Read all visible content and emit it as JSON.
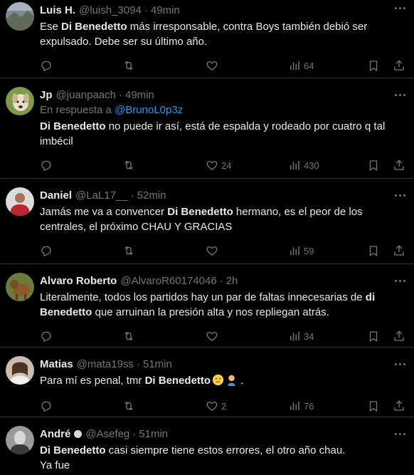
{
  "tweets": [
    {
      "name": "Luis H.",
      "handle": "@luish_3094",
      "time": "49min",
      "text_parts": [
        "Ese ",
        "Di Benedetto",
        " más irresponsable, contra Boys también debió ser expulsado. Debe ser su último año."
      ],
      "likes": "",
      "views": "64",
      "avatar_icon": "landscape-avatar"
    },
    {
      "name": "Jp",
      "handle": "@juanpaach",
      "time": "49min",
      "reply_prefix": "En respuesta a ",
      "reply_mention": "@BrunoL0p3z",
      "text_parts": [
        "Di Benedetto",
        " no puede ir así, está de espalda y rodeado por cuatro q tal imbécil"
      ],
      "likes": "24",
      "views": "430",
      "avatar_icon": "dog-avatar"
    },
    {
      "name": "Daniel",
      "handle": "@LaL17__",
      "time": "52min",
      "text_parts": [
        "Jamás me va a convencer ",
        "Di Benedetto",
        " hermano, es el peor de los centrales, el próximo CHAU Y GRACIAS"
      ],
      "likes": "",
      "views": "59",
      "avatar_icon": "player-avatar"
    },
    {
      "name": "Alvaro Roberto",
      "handle": "@AlvaroR60174046",
      "time": "2h",
      "text_parts": [
        "Literalmente, todos los partidos hay un par de faltas innecesarias de ",
        "di Benedetto",
        " que arruinan la presión alta y nos repliegan atrás."
      ],
      "likes": "",
      "views": "34",
      "avatar_icon": "dog-avatar"
    },
    {
      "name": "Matias",
      "handle": "@mata19ss",
      "time": "51min",
      "text_parts": [
        "Para mí es penal, tmr ",
        "Di Benedetto",
        ""
      ],
      "text_tail": " .",
      "likes": "2",
      "views": "76",
      "avatar_icon": "person-avatar"
    },
    {
      "name": "André",
      "handle": "@Asefeg",
      "time": "51min",
      "text_parts": [
        "Di Benedetto",
        " casi siempre tiene estos errores, el otro año chau."
      ],
      "text_line2": "Ya fue",
      "avatar_icon": "person-avatar"
    }
  ],
  "colors": {
    "background": "#000000",
    "text": "#e7e9ea",
    "muted": "#71767b",
    "link": "#1d9bf0",
    "divider": "#2f3336"
  },
  "icons": [
    "reply-icon",
    "retweet-icon",
    "like-icon",
    "views-icon",
    "bookmark-icon",
    "share-icon",
    "more-icon"
  ]
}
